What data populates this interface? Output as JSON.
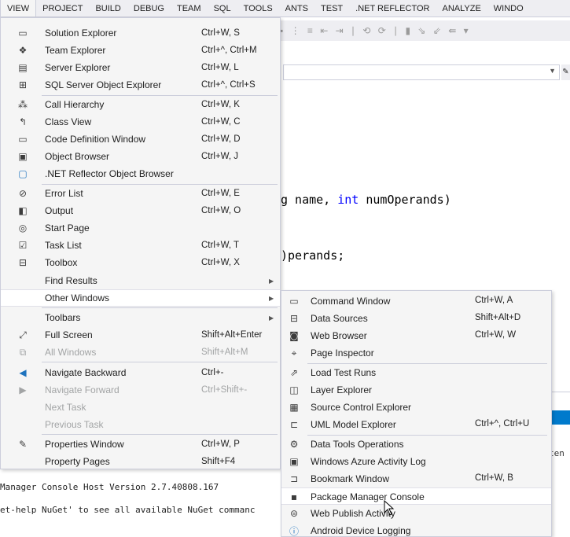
{
  "menubar": {
    "items": [
      "VIEW",
      "PROJECT",
      "BUILD",
      "DEBUG",
      "TEAM",
      "SQL",
      "TOOLS",
      "ANTS",
      "TEST",
      ".NET REFLECTOR",
      "ANALYZE",
      "WINDO"
    ]
  },
  "editor": {
    "line1_prefix": "g name, ",
    "line1_kw": "int",
    "line1_suffix": " numOperands)",
    "line2": ")perands;"
  },
  "console": {
    "line1": "Manager Console Host Version 2.7.40808.167",
    "line2": "et-help NuGet' to see all available NuGet commanc"
  },
  "output_text": "ten",
  "view_menu": {
    "items": [
      {
        "label": "Solution Explorer",
        "shortcut": "Ctrl+W, S",
        "icon": "solution-explorer-icon",
        "glyph": "▭"
      },
      {
        "label": "Team Explorer",
        "shortcut": "Ctrl+^, Ctrl+M",
        "icon": "team-explorer-icon",
        "glyph": "❖"
      },
      {
        "label": "Server Explorer",
        "shortcut": "Ctrl+W, L",
        "icon": "server-explorer-icon",
        "glyph": "▤"
      },
      {
        "label": "SQL Server Object Explorer",
        "shortcut": "Ctrl+^, Ctrl+S",
        "icon": "sql-object-explorer-icon",
        "glyph": "⊞"
      },
      {
        "label": "Call Hierarchy",
        "shortcut": "Ctrl+W, K",
        "icon": "call-hierarchy-icon",
        "glyph": "⁂"
      },
      {
        "label": "Class View",
        "shortcut": "Ctrl+W, C",
        "icon": "class-view-icon",
        "glyph": "↰"
      },
      {
        "label": "Code Definition Window",
        "shortcut": "Ctrl+W, D",
        "icon": "code-definition-icon",
        "glyph": "▭"
      },
      {
        "label": "Object Browser",
        "shortcut": "Ctrl+W, J",
        "icon": "object-browser-icon",
        "glyph": "▣"
      },
      {
        "label": ".NET Reflector Object Browser",
        "shortcut": "",
        "icon": "reflector-browser-icon",
        "glyph": "▢"
      },
      {
        "label": "Error List",
        "shortcut": "Ctrl+W, E",
        "icon": "error-list-icon",
        "glyph": "⊘"
      },
      {
        "label": "Output",
        "shortcut": "Ctrl+W, O",
        "icon": "output-icon",
        "glyph": "◧"
      },
      {
        "label": "Start Page",
        "shortcut": "",
        "icon": "start-page-icon",
        "glyph": "◎"
      },
      {
        "label": "Task List",
        "shortcut": "Ctrl+W, T",
        "icon": "task-list-icon",
        "glyph": "☑"
      },
      {
        "label": "Toolbox",
        "shortcut": "Ctrl+W, X",
        "icon": "toolbox-icon",
        "glyph": "⊟"
      },
      {
        "label": "Find Results",
        "shortcut": "",
        "icon": "",
        "glyph": ""
      },
      {
        "label": "Other Windows",
        "shortcut": "",
        "icon": "",
        "glyph": ""
      },
      {
        "label": "Toolbars",
        "shortcut": "",
        "icon": "",
        "glyph": ""
      },
      {
        "label": "Full Screen",
        "shortcut": "Shift+Alt+Enter",
        "icon": "full-screen-icon",
        "glyph": "⤢"
      },
      {
        "label": "All Windows",
        "shortcut": "Shift+Alt+M",
        "icon": "all-windows-icon",
        "glyph": "⧉"
      },
      {
        "label": "Navigate Backward",
        "shortcut": "Ctrl+-",
        "icon": "navigate-backward-icon",
        "glyph": "◀"
      },
      {
        "label": "Navigate Forward",
        "shortcut": "Ctrl+Shift+-",
        "icon": "navigate-forward-icon",
        "glyph": "▶"
      },
      {
        "label": "Next Task",
        "shortcut": "",
        "icon": "",
        "glyph": ""
      },
      {
        "label": "Previous Task",
        "shortcut": "",
        "icon": "",
        "glyph": ""
      },
      {
        "label": "Properties Window",
        "shortcut": "Ctrl+W, P",
        "icon": "properties-window-icon",
        "glyph": "🔧"
      },
      {
        "label": "Property Pages",
        "shortcut": "Shift+F4",
        "icon": "",
        "glyph": ""
      }
    ]
  },
  "other_windows_menu": {
    "items": [
      {
        "label": "Command Window",
        "shortcut": "Ctrl+W, A",
        "icon": "command-window-icon",
        "glyph": "▭"
      },
      {
        "label": "Data Sources",
        "shortcut": "Shift+Alt+D",
        "icon": "data-sources-icon",
        "glyph": "⊟"
      },
      {
        "label": "Web Browser",
        "shortcut": "Ctrl+W, W",
        "icon": "web-browser-icon",
        "glyph": "◙"
      },
      {
        "label": "Page Inspector",
        "shortcut": "",
        "icon": "page-inspector-icon",
        "glyph": "⌖"
      },
      {
        "label": "Load Test Runs",
        "shortcut": "",
        "icon": "load-test-runs-icon",
        "glyph": "⇗"
      },
      {
        "label": "Layer Explorer",
        "shortcut": "",
        "icon": "layer-explorer-icon",
        "glyph": "◫"
      },
      {
        "label": "Source Control Explorer",
        "shortcut": "",
        "icon": "source-control-icon",
        "glyph": "▦"
      },
      {
        "label": "UML Model Explorer",
        "shortcut": "Ctrl+^, Ctrl+U",
        "icon": "uml-model-icon",
        "glyph": "⊏"
      },
      {
        "label": "Data Tools Operations",
        "shortcut": "",
        "icon": "data-tools-icon",
        "glyph": "⚙"
      },
      {
        "label": "Windows Azure Activity Log",
        "shortcut": "",
        "icon": "azure-activity-log-icon",
        "glyph": "▣"
      },
      {
        "label": "Bookmark Window",
        "shortcut": "Ctrl+W, B",
        "icon": "bookmark-window-icon",
        "glyph": "⊐"
      },
      {
        "label": "Package Manager Console",
        "shortcut": "",
        "icon": "package-manager-icon",
        "glyph": "▪"
      },
      {
        "label": "Web Publish Activity",
        "shortcut": "",
        "icon": "web-publish-icon",
        "glyph": "⊜"
      },
      {
        "label": "Android Device Logging",
        "shortcut": "",
        "icon": "info-icon",
        "glyph": "ⓘ"
      }
    ]
  }
}
